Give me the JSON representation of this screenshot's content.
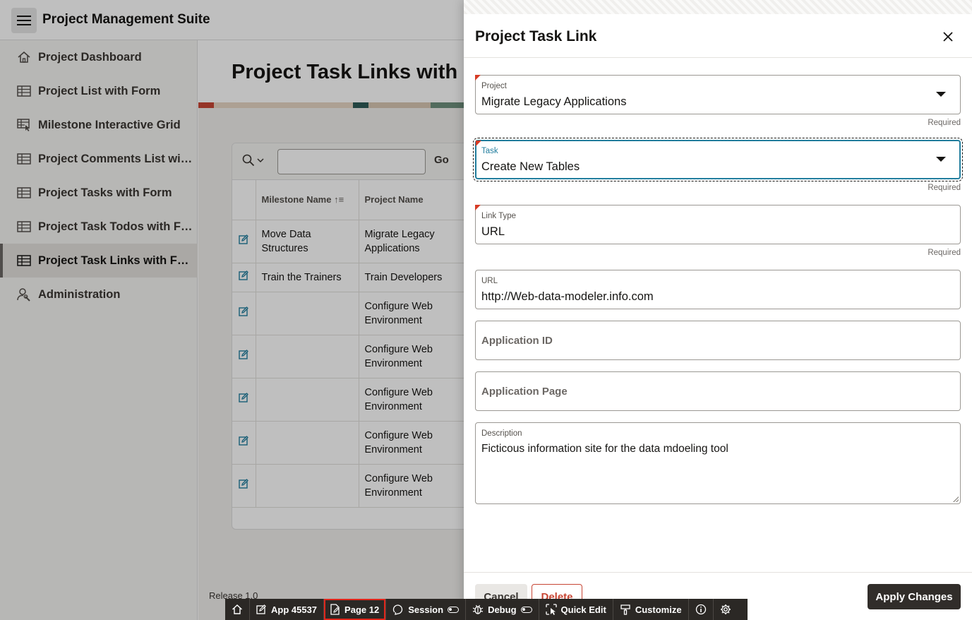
{
  "app": {
    "title": "Project Management Suite"
  },
  "sidebar": {
    "items": [
      {
        "label": "Project Dashboard",
        "icon": "home-icon"
      },
      {
        "label": "Project List with Form",
        "icon": "table-icon"
      },
      {
        "label": "Milestone Interactive Grid",
        "icon": "grid-cursor-icon"
      },
      {
        "label": "Project Comments List wit...",
        "icon": "table-icon"
      },
      {
        "label": "Project Tasks with Form",
        "icon": "table-icon"
      },
      {
        "label": "Project Task Todos with Form",
        "icon": "table-icon"
      },
      {
        "label": "Project Task Links with Form",
        "icon": "table-icon",
        "active": true
      },
      {
        "label": "Administration",
        "icon": "user-wrench-icon"
      }
    ]
  },
  "page": {
    "title": "Project Task Links with Form"
  },
  "report": {
    "go_label": "Go",
    "columns": [
      "Milestone Name",
      "Project Name"
    ],
    "rows": [
      {
        "milestone": "Move Data Structures",
        "project": "Migrate Legacy Applications"
      },
      {
        "milestone": "Train the Trainers",
        "project": "Train Developers"
      },
      {
        "milestone": "",
        "project": "Configure Web Environment"
      },
      {
        "milestone": "",
        "project": "Configure Web Environment"
      },
      {
        "milestone": "",
        "project": "Configure Web Environment"
      },
      {
        "milestone": "",
        "project": "Configure Web Environment"
      },
      {
        "milestone": "",
        "project": "Configure Web Environment"
      }
    ]
  },
  "footer": {
    "release": "Release 1.0"
  },
  "drawer": {
    "title": "Project Task Link",
    "required_text": "Required",
    "fields": {
      "project": {
        "label": "Project",
        "value": "Migrate Legacy Applications"
      },
      "task": {
        "label": "Task",
        "value": "Create New Tables"
      },
      "link_type": {
        "label": "Link Type",
        "value": "URL"
      },
      "url": {
        "label": "URL",
        "value": "http://Web-data-modeler.info.com"
      },
      "application_id": {
        "label": "Application ID"
      },
      "application_page": {
        "label": "Application Page"
      },
      "description": {
        "label": "Description",
        "value": "Ficticous information site for the data mdoeling tool"
      }
    },
    "buttons": {
      "cancel": "Cancel",
      "delete": "Delete",
      "apply": "Apply Changes"
    }
  },
  "devbar": {
    "app": "App 45537",
    "page": "Page 12",
    "session": "Session",
    "debug": "Debug",
    "quick_edit": "Quick Edit",
    "customize": "Customize"
  },
  "colors": {
    "focus": "#227e9e",
    "required_marker": "#d63b25",
    "apply_button": "#312d2a",
    "delete_accent": "#c74634",
    "devbar": "#2b2825",
    "highlight": "#e0261b"
  }
}
